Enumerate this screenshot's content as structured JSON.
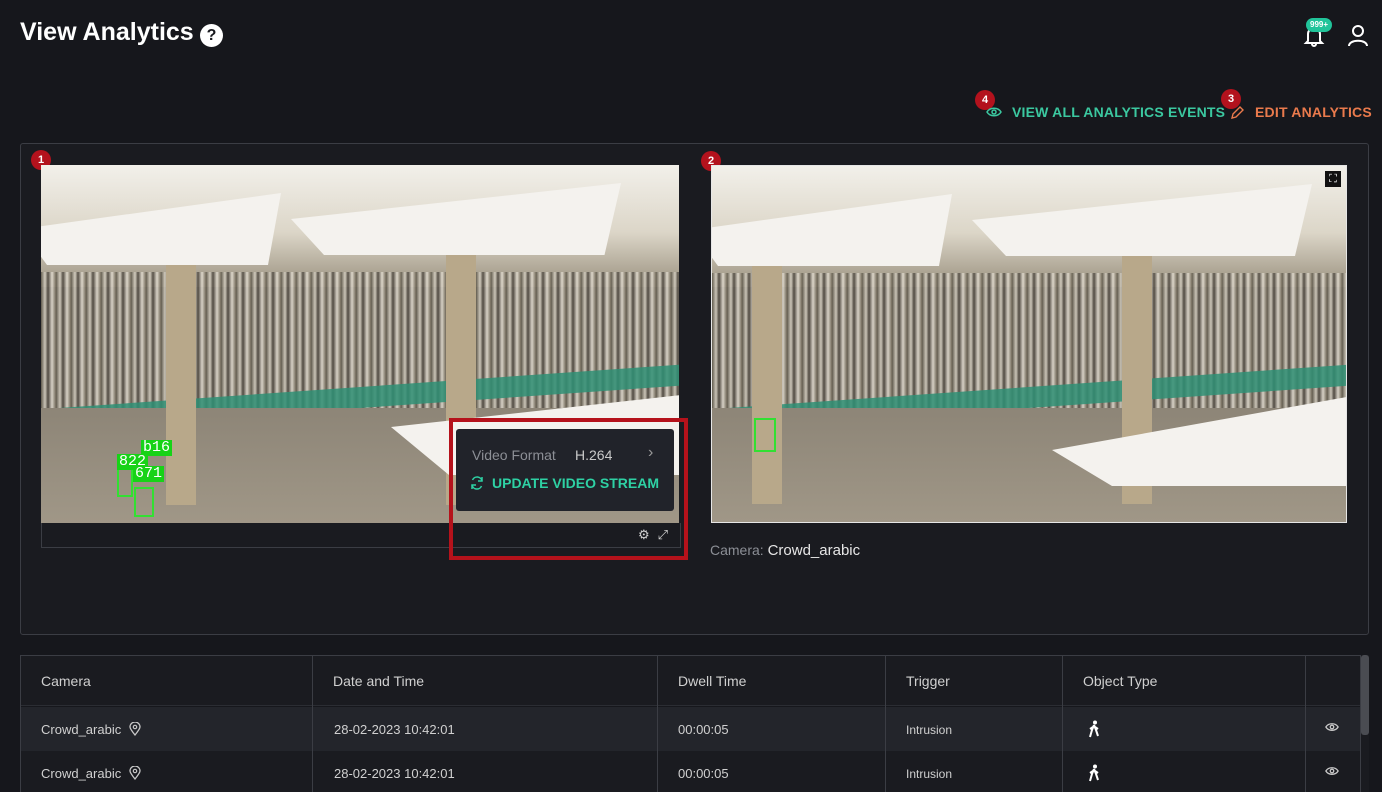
{
  "header": {
    "title": "View Analytics",
    "help_icon": "question-circle-icon",
    "notification_badge": "999+",
    "bell_icon": "bell-icon",
    "user_icon": "user-icon"
  },
  "actions": {
    "view_all_label": "VIEW ALL ANALYTICS EVENTS",
    "view_all_step": "4",
    "edit_label": "EDIT ANALYTICS",
    "edit_step": "3",
    "view_all_color": "#3bc8a0",
    "edit_color": "#ea7a4c"
  },
  "feeds": {
    "left": {
      "step": "1",
      "detection_labels": [
        "b16",
        "822",
        "671"
      ]
    },
    "right": {
      "step": "2",
      "camera_prefix": "Camera:",
      "camera_name": "Crowd_arabic"
    }
  },
  "popup": {
    "format_label": "Video Format",
    "format_value": "H.264",
    "update_label": "UPDATE VIDEO STREAM"
  },
  "table": {
    "headers": [
      "Camera",
      "Date and Time",
      "Dwell Time",
      "Trigger",
      "Object Type"
    ],
    "rows": [
      {
        "camera": "Crowd_arabic",
        "datetime": "28-02-2023 10:42:01",
        "dwell": "00:00:05",
        "trigger": "Intrusion",
        "object_icon": "person-walking-icon"
      },
      {
        "camera": "Crowd_arabic",
        "datetime": "28-02-2023 10:42:01",
        "dwell": "00:00:05",
        "trigger": "Intrusion",
        "object_icon": "person-walking-icon"
      }
    ]
  },
  "colors": {
    "accent_green": "#21c49a",
    "highlight_red": "#b5121b",
    "detection_green": "#32e032"
  }
}
